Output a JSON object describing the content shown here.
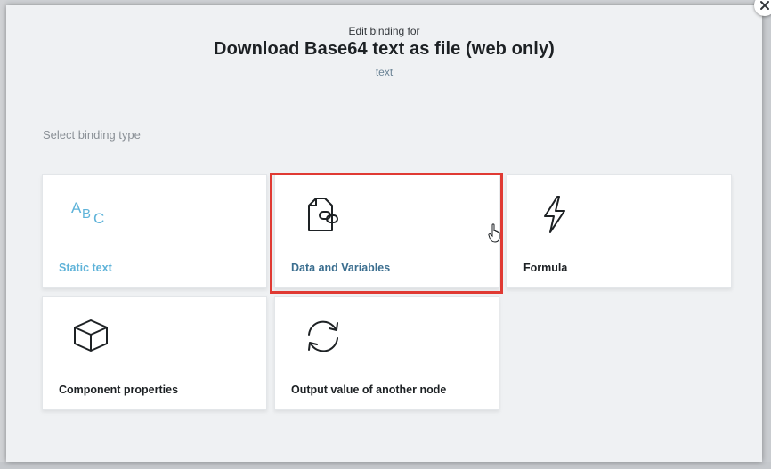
{
  "header": {
    "kicker": "Edit binding for",
    "title": "Download Base64 text as file (web only)",
    "subtitle": "text"
  },
  "section_label": "Select binding type",
  "cards": [
    {
      "label": "Static text",
      "icon": "abc-text-icon"
    },
    {
      "label": "Data and Variables",
      "icon": "document-link-icon"
    },
    {
      "label": "Formula",
      "icon": "lightning-icon"
    },
    {
      "label": "Component properties",
      "icon": "cube-icon"
    },
    {
      "label": "Output value of another node",
      "icon": "refresh-cycle-icon"
    }
  ],
  "icon_text": {
    "abc": [
      "A",
      "B",
      "C"
    ]
  },
  "colors": {
    "accent": "#5fb3d9",
    "link_label": "#3b6e8f",
    "highlight": "#e03a33",
    "dialog_bg": "#eff1f3"
  }
}
